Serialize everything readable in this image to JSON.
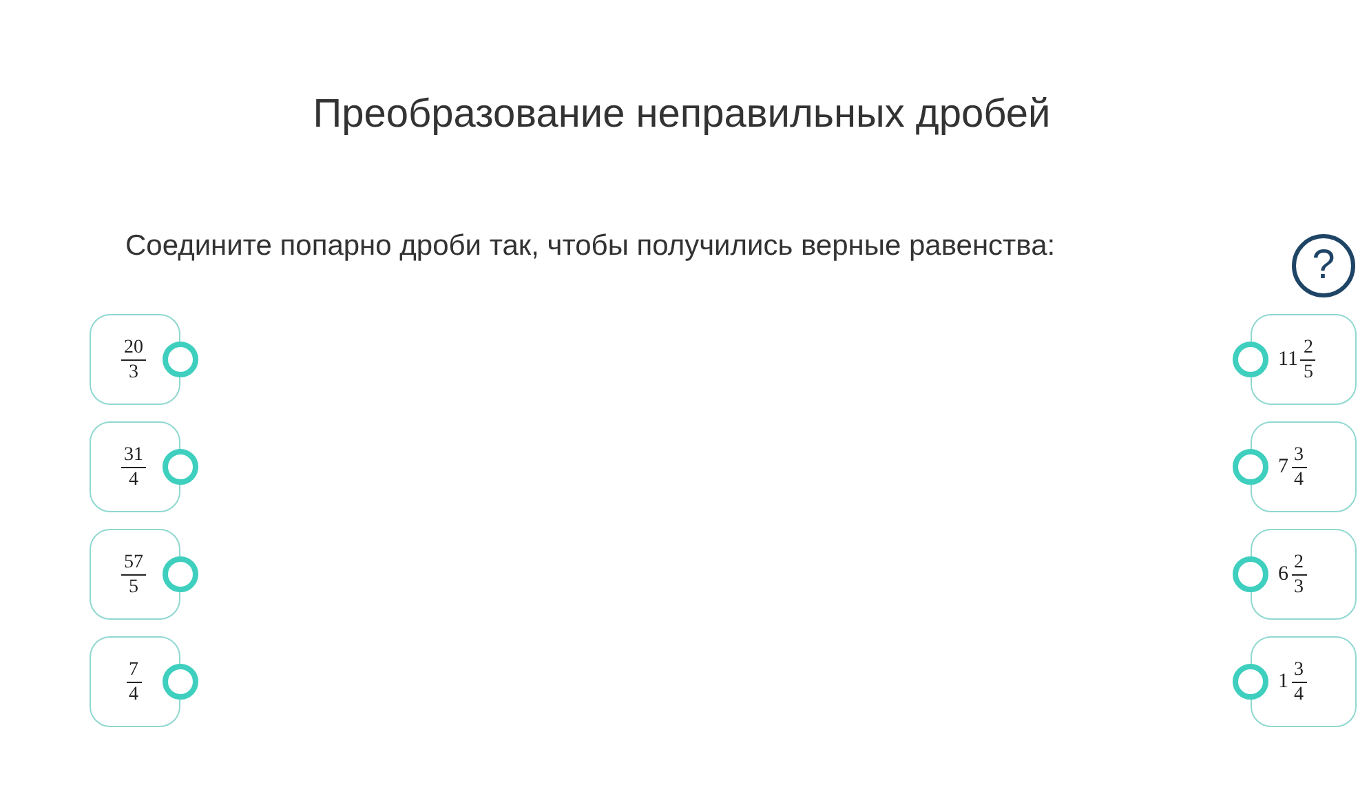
{
  "title": "Преобразование неправильных дробей",
  "instruction": "Соедините попарно дроби так, чтобы получились верные равенства:",
  "help": {
    "label": "?"
  },
  "left_items": [
    {
      "numerator": "20",
      "denominator": "3"
    },
    {
      "numerator": "31",
      "denominator": "4"
    },
    {
      "numerator": "57",
      "denominator": "5"
    },
    {
      "numerator": "7",
      "denominator": "4"
    }
  ],
  "right_items": [
    {
      "whole": "11",
      "numerator": "2",
      "denominator": "5"
    },
    {
      "whole": "7",
      "numerator": "3",
      "denominator": "4"
    },
    {
      "whole": "6",
      "numerator": "2",
      "denominator": "3"
    },
    {
      "whole": "1",
      "numerator": "3",
      "denominator": "4"
    }
  ]
}
